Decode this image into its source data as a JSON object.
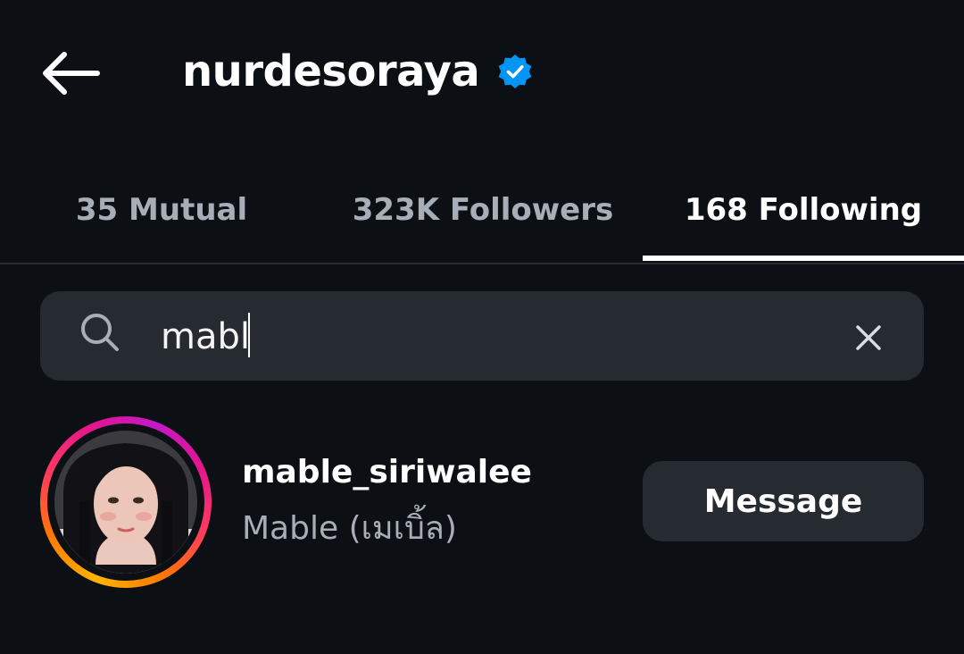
{
  "header": {
    "title": "nurdesoraya",
    "verified_icon": "verified-badge-icon",
    "back_icon": "arrow-left-icon"
  },
  "tabs": [
    {
      "label": "35 Mutual",
      "active": false
    },
    {
      "label": "323K Followers",
      "active": false
    },
    {
      "label": "168 Following",
      "active": true
    }
  ],
  "search": {
    "value": "mabl",
    "icon": "search-icon",
    "clear_icon": "close-icon"
  },
  "results": [
    {
      "username": "mable_siriwalee",
      "full_name": "Mable (เมเบิ้ล)",
      "button_label": "Message",
      "has_story_ring": true
    }
  ],
  "colors": {
    "background": "#0c0f14",
    "surface": "#262a31",
    "secondary_text": "#a8aeb7",
    "verified_blue": "#0095f6"
  }
}
